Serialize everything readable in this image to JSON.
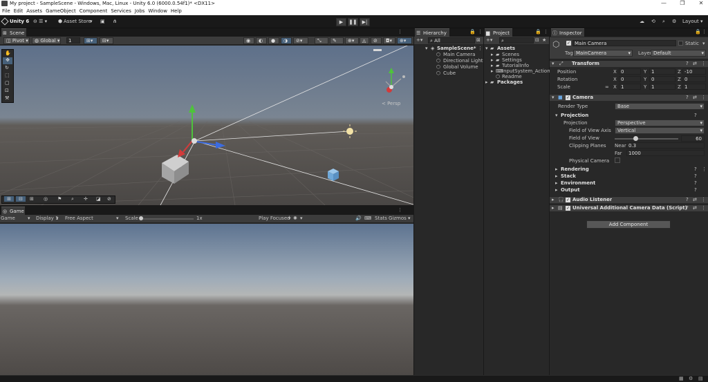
{
  "window": {
    "title": "My project - SampleScene - Windows, Mac, Linux - Unity 6.0 (6000.0.54f1)* <DX11>",
    "controls": [
      "—",
      "❐",
      "✕"
    ]
  },
  "menu": [
    "File",
    "Edit",
    "Assets",
    "GameObject",
    "Component",
    "Services",
    "Jobs",
    "Window",
    "Help"
  ],
  "toolbar": {
    "unity_label": "Unity 6",
    "asset_store": "Asset Store",
    "layout_label": "Layout"
  },
  "scene": {
    "tab": "Scene",
    "pivot": "Pivot",
    "global": "Global",
    "grid_value": "1",
    "persp": "< Persp"
  },
  "game": {
    "tab": "Game",
    "mode": "Game",
    "display": "Display 1",
    "aspect": "Free Aspect",
    "scale_label": "Scale",
    "scale_value": "1x",
    "play_focused": "Play Focused",
    "stats": "Stats",
    "gizmos": "Gizmos"
  },
  "hierarchy": {
    "tab": "Hierarchy",
    "search": "All",
    "scene": "SampleScene*",
    "items": [
      "Main Camera",
      "Directional Light",
      "Global Volume",
      "Cube"
    ]
  },
  "project": {
    "tab": "Project",
    "assets": "Assets",
    "folders": [
      "Scenes",
      "Settings",
      "TutorialInfo",
      "InputSystem_Actions",
      "Readme"
    ],
    "packages": "Packages"
  },
  "inspector": {
    "tab": "Inspector",
    "object_name": "Main Camera",
    "static": "Static",
    "tag_label": "Tag",
    "tag_value": "MainCamera",
    "layer_label": "Layer",
    "layer_value": "Default",
    "transform": {
      "title": "Transform",
      "rows": [
        {
          "label": "Position",
          "x": "0",
          "y": "1",
          "z": "-10"
        },
        {
          "label": "Rotation",
          "x": "0",
          "y": "0",
          "z": "0"
        },
        {
          "label": "Scale",
          "x": "1",
          "y": "1",
          "z": "1"
        }
      ],
      "axis": [
        "X",
        "Y",
        "Z"
      ]
    },
    "camera": {
      "title": "Camera",
      "render_type_label": "Render Type",
      "render_type_value": "Base",
      "projection_header": "Projection",
      "projection_label": "Projection",
      "projection_value": "Perspective",
      "fov_axis_label": "Field of View Axis",
      "fov_axis_value": "Vertical",
      "fov_label": "Field of View",
      "fov_value": "60",
      "fov_fraction": 0.33,
      "clipping_label": "Clipping Planes",
      "near_label": "Near",
      "near_value": "0.3",
      "far_label": "Far",
      "far_value": "1000",
      "physical_label": "Physical Camera",
      "sections": [
        "Rendering",
        "Stack",
        "Environment",
        "Output"
      ]
    },
    "audio_listener": "Audio Listener",
    "urp_data": "Universal Additional Camera Data (Script)",
    "add_component": "Add Component"
  },
  "colors": {
    "accent": "#2c5d87",
    "sky_top": "#5d7390",
    "ground": "#4d4946"
  }
}
